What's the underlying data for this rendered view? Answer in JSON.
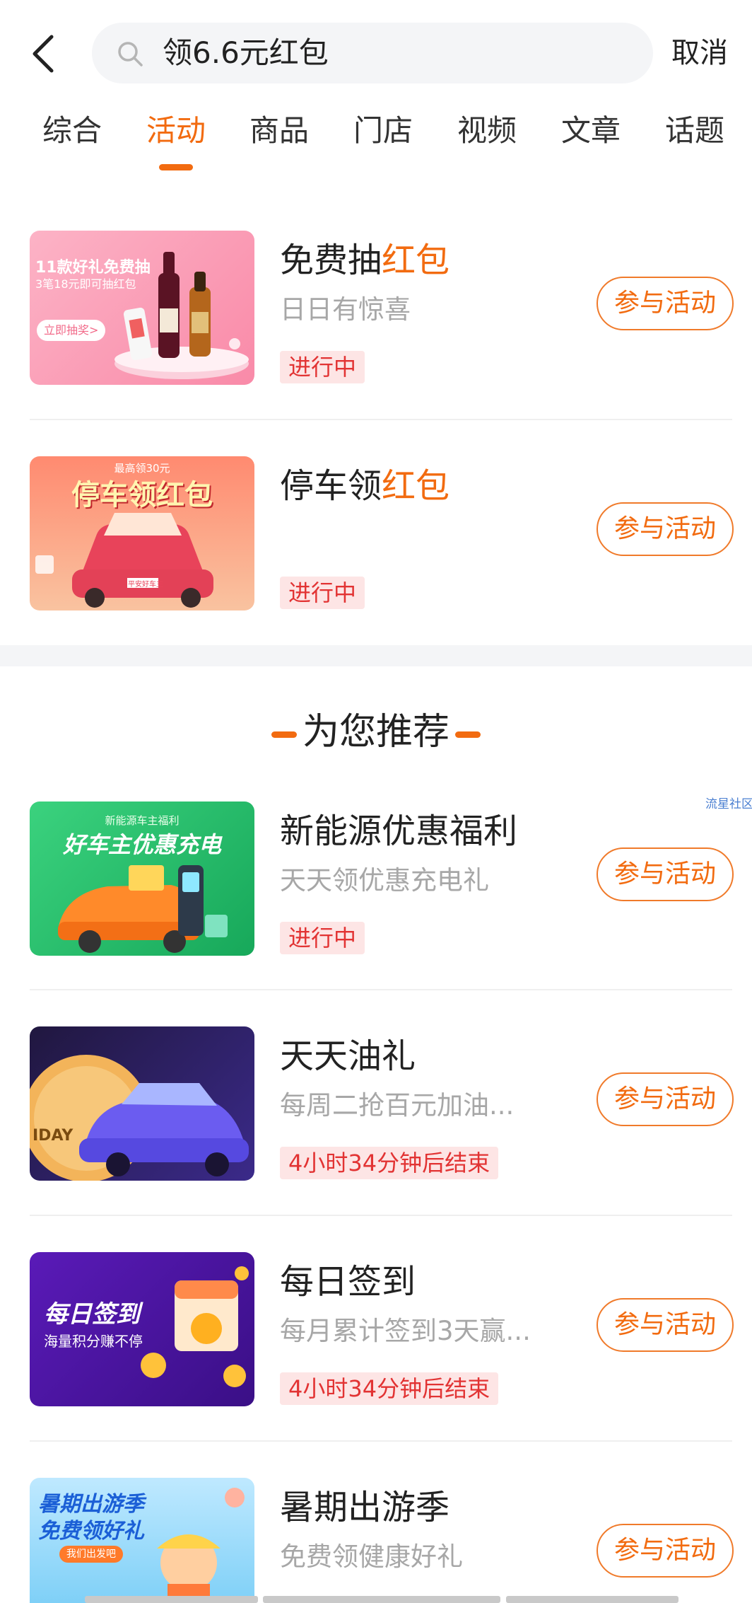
{
  "header": {
    "search_text": "领6.6元红包",
    "cancel_label": "取消"
  },
  "tabs": [
    {
      "label": "综合",
      "active": false
    },
    {
      "label": "活动",
      "active": true
    },
    {
      "label": "商品",
      "active": false
    },
    {
      "label": "门店",
      "active": false
    },
    {
      "label": "视频",
      "active": false
    },
    {
      "label": "文章",
      "active": false
    },
    {
      "label": "话题",
      "active": false
    }
  ],
  "activities": [
    {
      "title_plain": "免费抽",
      "title_highlight": "红包",
      "subtitle": "日日有惊喜",
      "status": "进行中",
      "button": "参与活动",
      "thumb_text": [
        "11款好礼免费抽",
        "3笔18元即可抽红包",
        "立即抽奖>"
      ]
    },
    {
      "title_plain": "停车领",
      "title_highlight": "红包",
      "subtitle": "",
      "status": "进行中",
      "button": "参与活动",
      "thumb_text": [
        "最高领30元",
        "停车领红包",
        "平安好车主"
      ]
    }
  ],
  "recommend": {
    "heading": "为您推荐",
    "watermark": "流星社区",
    "items": [
      {
        "title": "新能源优惠福利",
        "subtitle": "天天领优惠充电礼",
        "status": "进行中",
        "button": "参与活动",
        "thumb_text": [
          "新能源车主福利",
          "好车主优惠充电"
        ]
      },
      {
        "title": "天天油礼",
        "subtitle": "每周二抢百元加油...",
        "status": "4小时34分钟后结束",
        "button": "参与活动",
        "thumb_text": [
          "IDAY"
        ]
      },
      {
        "title": "每日签到",
        "subtitle": "每月累计签到3天赢...",
        "status": "4小时34分钟后结束",
        "button": "参与活动",
        "thumb_text": [
          "每日签到",
          "海量积分赚不停"
        ]
      },
      {
        "title": "暑期出游季",
        "subtitle": "免费领健康好礼",
        "status": "",
        "button": "参与活动",
        "thumb_text": [
          "暑期出游季",
          "免费领好礼",
          "我们出发吧"
        ]
      }
    ]
  },
  "colors": {
    "accent": "#f26b10",
    "status_text": "#e23333",
    "status_bg": "#fde5e5",
    "muted_text": "#a7a7a7"
  }
}
